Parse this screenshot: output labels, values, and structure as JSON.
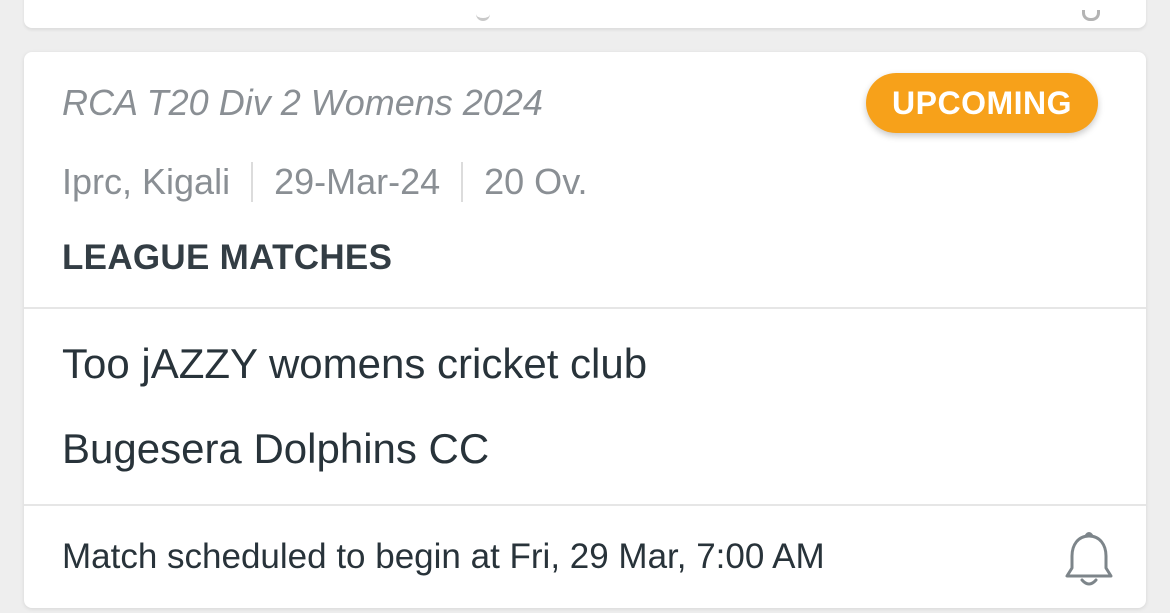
{
  "match_card": {
    "tournament": "RCA T20 Div 2 Womens 2024",
    "status": "UPCOMING",
    "status_color": "#f7a11a",
    "venue": "Iprc, Kigali",
    "date": "29-Mar-24",
    "overs": "20 Ov.",
    "stage": "LEAGUE MATCHES",
    "teams": [
      "Too jAZZY womens cricket club",
      "Bugesera Dolphins CC"
    ],
    "schedule_text": "Match scheduled to begin at Fri, 29 Mar, 7:00 AM",
    "reminder_icon": "bell-icon"
  }
}
